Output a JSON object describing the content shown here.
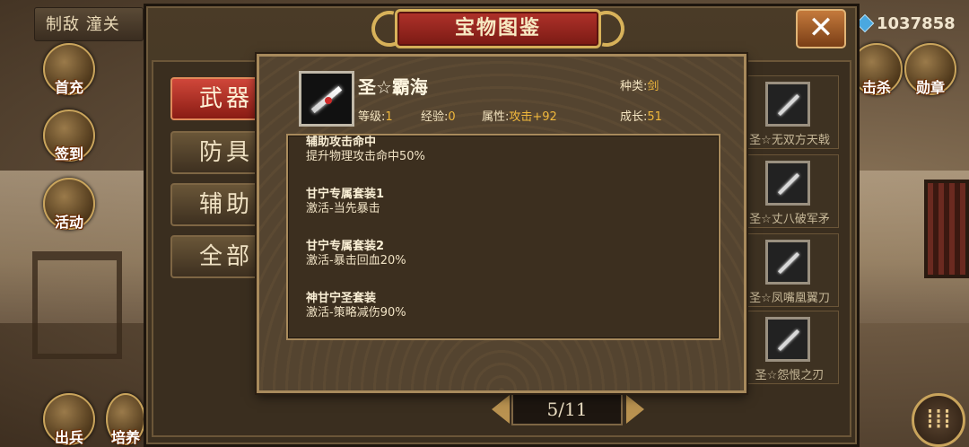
{
  "top_left": {
    "label": "制敌 潼关"
  },
  "resource": {
    "amount": "1037858",
    "icon": "blue-gem-icon"
  },
  "side_buttons": [
    {
      "label": "首充",
      "icon": "first-charge-icon"
    },
    {
      "label": "签到",
      "icon": "sign-in-icon"
    },
    {
      "label": "活动",
      "icon": "activity-icon"
    },
    {
      "label": "出兵",
      "icon": "dispatch-icon"
    },
    {
      "label": "培养",
      "icon": "train-icon"
    }
  ],
  "right_buttons": [
    {
      "label": "击杀",
      "icon": "kill-icon"
    },
    {
      "label": "勋章",
      "icon": "medal-icon"
    }
  ],
  "window": {
    "title": "宝物图鉴",
    "close_icon": "close-icon"
  },
  "tabs": [
    {
      "label": "武器",
      "active": true
    },
    {
      "label": "防具",
      "active": false
    },
    {
      "label": "辅助",
      "active": false
    },
    {
      "label": "全部",
      "active": false
    }
  ],
  "item_list": [
    {
      "name": "圣☆无双方天戟"
    },
    {
      "name": "圣☆丈八破军矛"
    },
    {
      "name": "圣☆凤嘴凰翼刀"
    },
    {
      "name": "圣☆怨恨之刃"
    }
  ],
  "detail": {
    "name": "圣☆霸海",
    "type_label": "种类:",
    "type_value": "剑",
    "level_label": "等级:",
    "level_value": "1",
    "exp_label": "经验:",
    "exp_value": "0",
    "attr_label": "属性:",
    "attr_value": "攻击+92",
    "growth_label": "成长:",
    "growth_value": "51",
    "effects": [
      {
        "title": "辅助攻击命中",
        "desc": "提升物理攻击命中50%"
      },
      {
        "title": "甘宁专属套装1",
        "desc": "激活-当先暴击"
      },
      {
        "title": "甘宁专属套装2",
        "desc": "激活-暴击回血20%"
      },
      {
        "title": "神甘宁圣套装",
        "desc": "激活-策略减伤90%"
      }
    ]
  },
  "pager": {
    "text": "5/11"
  }
}
